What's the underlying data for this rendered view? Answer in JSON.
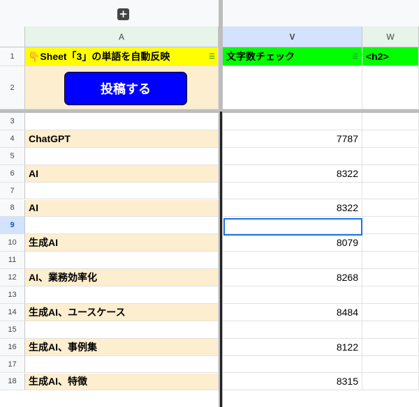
{
  "toolbar": {
    "add_icon": "+"
  },
  "columns": {
    "A": "A",
    "V": "V",
    "W": "W"
  },
  "header_row": {
    "a1_label": "👇Sheet「3」の単語を自動反映",
    "v1_label": "文字数チェック",
    "w1_label": "<h2>",
    "filter_glyph": "☰"
  },
  "post_button": {
    "label": "投稿する"
  },
  "rows": [
    {
      "n": "1"
    },
    {
      "n": "2"
    },
    {
      "n": "3",
      "a": "",
      "v": ""
    },
    {
      "n": "4",
      "a": "ChatGPT",
      "v": "7787"
    },
    {
      "n": "5",
      "a": "",
      "v": ""
    },
    {
      "n": "6",
      "a": "AI",
      "v": "8322"
    },
    {
      "n": "7",
      "a": "",
      "v": ""
    },
    {
      "n": "8",
      "a": "AI",
      "v": "8322"
    },
    {
      "n": "9",
      "a": "",
      "v": ""
    },
    {
      "n": "10",
      "a": "生成AI",
      "v": "8079"
    },
    {
      "n": "11",
      "a": "",
      "v": ""
    },
    {
      "n": "12",
      "a": "AI、業務効率化",
      "v": "8268"
    },
    {
      "n": "13",
      "a": "",
      "v": ""
    },
    {
      "n": "14",
      "a": "生成AI、ユースケース",
      "v": "8484"
    },
    {
      "n": "15",
      "a": "",
      "v": ""
    },
    {
      "n": "16",
      "a": "生成AI、事例集",
      "v": "8122"
    },
    {
      "n": "17",
      "a": "",
      "v": ""
    },
    {
      "n": "18",
      "a": "生成AI、特徴",
      "v": "8315"
    }
  ]
}
